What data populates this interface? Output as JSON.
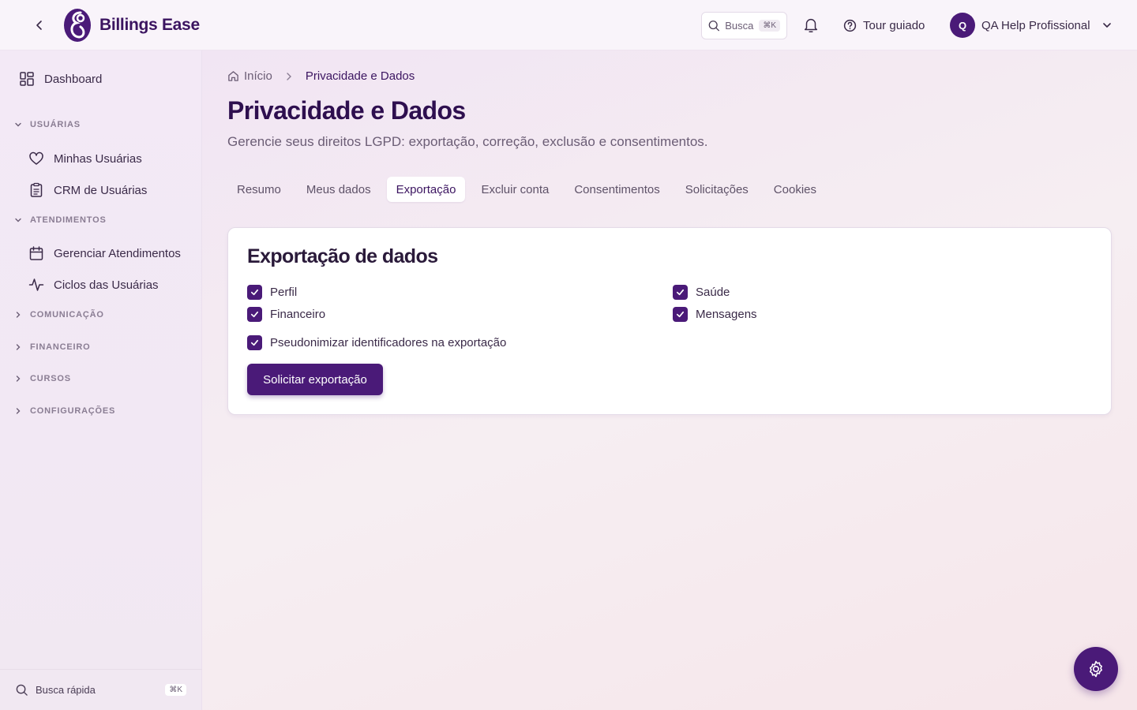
{
  "app": {
    "name": "Billings Ease"
  },
  "header": {
    "search_label": "Busca",
    "search_shortcut": "⌘K",
    "tour_label": "Tour guiado",
    "user_initial": "Q",
    "user_name": "QA Help Profissional"
  },
  "sidebar": {
    "dashboard": "Dashboard",
    "sections": {
      "usuarias": {
        "label": "USUÁRIAS",
        "expanded": true,
        "items": [
          "Minhas Usuárias",
          "CRM de Usuárias"
        ]
      },
      "atendimentos": {
        "label": "ATENDIMENTOS",
        "expanded": true,
        "items": [
          "Gerenciar Atendimentos",
          "Ciclos das Usuárias"
        ]
      },
      "comunicacao": {
        "label": "COMUNICAÇÃO",
        "expanded": false
      },
      "financeiro": {
        "label": "FINANCEIRO",
        "expanded": false
      },
      "cursos": {
        "label": "CURSOS",
        "expanded": false
      },
      "configuracoes": {
        "label": "CONFIGURAÇÕES",
        "expanded": false
      }
    },
    "quick_search": "Busca rápida",
    "quick_search_shortcut": "⌘K"
  },
  "breadcrumb": {
    "home": "Início",
    "current": "Privacidade e Dados"
  },
  "page": {
    "title": "Privacidade e Dados",
    "subtitle": "Gerencie seus direitos LGPD: exportação, correção, exclusão e consentimentos."
  },
  "tabs": [
    {
      "label": "Resumo",
      "active": false
    },
    {
      "label": "Meus dados",
      "active": false
    },
    {
      "label": "Exportação",
      "active": true
    },
    {
      "label": "Excluir conta",
      "active": false
    },
    {
      "label": "Consentimentos",
      "active": false
    },
    {
      "label": "Solicitações",
      "active": false
    },
    {
      "label": "Cookies",
      "active": false
    }
  ],
  "export_card": {
    "title": "Exportação de dados",
    "options": [
      {
        "label": "Perfil",
        "checked": true
      },
      {
        "label": "Saúde",
        "checked": true
      },
      {
        "label": "Financeiro",
        "checked": true
      },
      {
        "label": "Mensagens",
        "checked": true
      }
    ],
    "pseudonymize": {
      "label": "Pseudonimizar identificadores na exportação",
      "checked": true
    },
    "submit_label": "Solicitar exportação"
  },
  "colors": {
    "primary": "#4a1a78",
    "title": "#2e0f4f"
  }
}
